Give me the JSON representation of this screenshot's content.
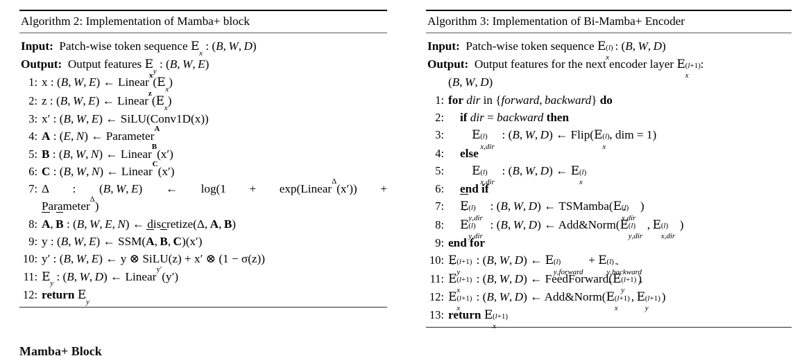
{
  "page": {
    "bottom_partial_heading": "Mamba+ Block"
  },
  "algorithms": [
    {
      "id": "algorithm-2",
      "title": "Algorithm 2: Implementation of Mamba+ block",
      "input_label": "Input:",
      "input_text": "Patch-wise token sequence E_x : (B, W, D)",
      "output_label": "Output:",
      "output_text": "Output features E_y : (B, W, E)",
      "steps": [
        {
          "num": "1:",
          "text": "x : (B, W, E) ← Linear^x(E_x)"
        },
        {
          "num": "2:",
          "text": "z : (B, W, E) ← Linear^z(E_x)"
        },
        {
          "num": "3:",
          "text": "x′ : (B, W, E) ← SiLU(Conv1D(x))"
        },
        {
          "num": "4:",
          "text": "A : (E, N) ← Parameter^A"
        },
        {
          "num": "5:",
          "text": "B : (B, W, N) ← Linear^B(x′)"
        },
        {
          "num": "6:",
          "text": "C : (B, W, N) ← Linear^C(x′)"
        },
        {
          "num": "7:",
          "text": "Δ : (B, W, E) ← log(1 + exp(Linear^Δ(x′)) + Parameter^Δ)"
        },
        {
          "num": "8:",
          "text": "A̅, B̅ : (B, W, E, N) ← discretize(Δ, A, B)"
        },
        {
          "num": "9:",
          "text": "y : (B, W, E) ← SSM(A̅, B̅, C)(x′)"
        },
        {
          "num": "10:",
          "text": "y′ : (B, W, E) ← y ⊗ SiLU(z) + x′ ⊗ (1 − σ(z))"
        },
        {
          "num": "11:",
          "text": "E_y : (B, W, D) ← Linear^{y′}(y′)"
        },
        {
          "num": "12:",
          "text": "return E_y"
        }
      ]
    },
    {
      "id": "algorithm-3",
      "title": "Algorithm 3: Implementation of Bi-Mamba+ Encoder",
      "input_label": "Input:",
      "input_text": "Patch-wise token sequence E_x^(l) : (B, W, D)",
      "output_label": "Output:",
      "output_text": "Output features for the next encoder layer E_x^(l+1) : (B, W, D)",
      "steps": [
        {
          "num": "1:",
          "text": "for dir in {forward, backward} do"
        },
        {
          "num": "2:",
          "text": "if dir = backward then"
        },
        {
          "num": "3:",
          "text": "E_{x,dir}^(l) : (B, W, D) ← Flip(E_x^(l), dim = 1)"
        },
        {
          "num": "4:",
          "text": "else"
        },
        {
          "num": "5:",
          "text": "E_{x,dir}^(l) : (B, W, D) ← E_x^(l)"
        },
        {
          "num": "6:",
          "text": "end if"
        },
        {
          "num": "7:",
          "text": "E̅_{y,dir}^(l) : (B, W, D) ← TSMamba(E_{x,dir}^(l))"
        },
        {
          "num": "8:",
          "text": "Ẽ_{y,dir}^(l) : (B, W, D) ← Add&Norm(E̅_{y,dir}^(l), E_{x,dir}^(l))"
        },
        {
          "num": "9:",
          "text": "end for"
        },
        {
          "num": "10:",
          "text": "Ẽ_y^(l+1) : (B, W, D) ← E_{y,forward}^(l) + E_{y,backward}^(l)"
        },
        {
          "num": "11:",
          "text": "Ẽ_x^(l+1) : (B, W, D) ← FeedForward(Ẽ_y^(l+1))"
        },
        {
          "num": "12:",
          "text": "E_x^(l+1) : (B, W, D) ← Add&Norm(Ẽ_x^(l+1), Ẽ_y^(l+1))"
        },
        {
          "num": "13:",
          "text": "return E_x^(l+1)"
        }
      ]
    }
  ]
}
